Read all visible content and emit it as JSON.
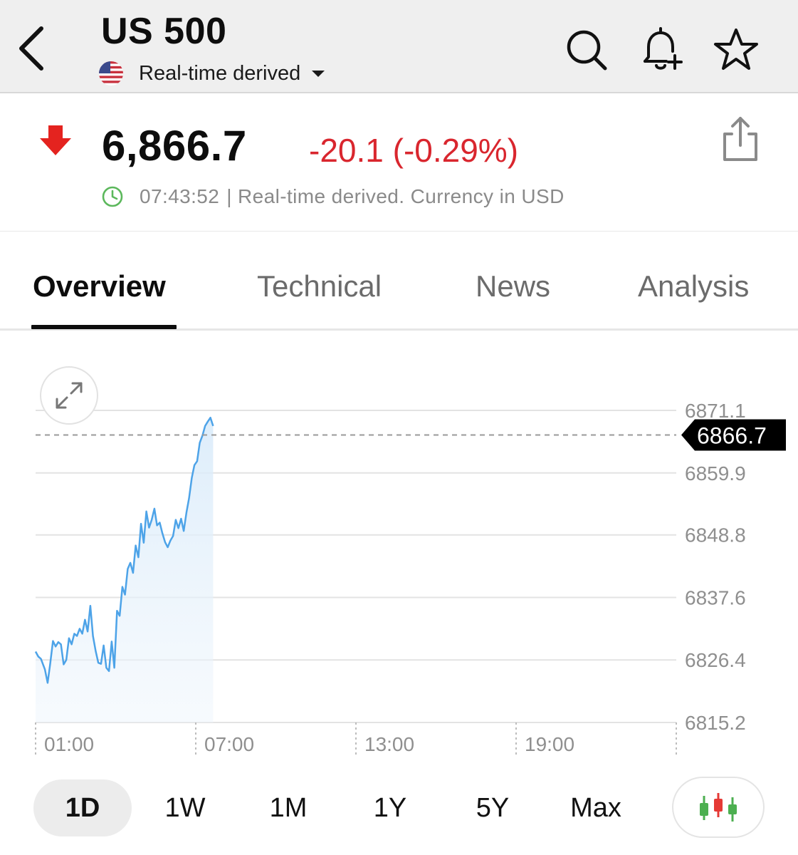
{
  "header": {
    "title": "US 500",
    "subtitle": "Real-time derived",
    "icons": {
      "back": "back-chevron-icon",
      "search": "search-icon",
      "alert": "bell-plus-icon",
      "watch": "star-icon",
      "flag": "us-flag-icon"
    }
  },
  "quote": {
    "price": "6,866.7",
    "change": "-20.1 (-0.29%)",
    "direction": "down",
    "time": "07:43:52",
    "note": "| Real-time derived. Currency in USD",
    "down_color": "#d9262e"
  },
  "tabs": [
    {
      "label": "Overview",
      "active": true
    },
    {
      "label": "Technical",
      "active": false
    },
    {
      "label": "News",
      "active": false
    },
    {
      "label": "Analysis",
      "active": false
    }
  ],
  "chart_data": {
    "type": "area",
    "y_ticks": [
      "6871.1",
      "6859.9",
      "6848.8",
      "6837.6",
      "6826.4",
      "6815.2"
    ],
    "ylim": [
      6815.2,
      6871.1
    ],
    "x_ticks": [
      "01:00",
      "07:00",
      "13:00",
      "19:00"
    ],
    "x_range_hours": [
      0,
      24
    ],
    "current_price_label": "6866.7",
    "current_price": 6866.7,
    "line_color": "#4da3e8",
    "grid": true,
    "series": [
      {
        "x": [
          0.0,
          0.1,
          0.2,
          0.35,
          0.45,
          0.55,
          0.65,
          0.75,
          0.85,
          0.95,
          1.05,
          1.15,
          1.25,
          1.35,
          1.45,
          1.55,
          1.65,
          1.75,
          1.85,
          1.95,
          2.05,
          2.15,
          2.25,
          2.35,
          2.45,
          2.55,
          2.65,
          2.75,
          2.85,
          2.95,
          3.05,
          3.15,
          3.25,
          3.35,
          3.45,
          3.55,
          3.65,
          3.75,
          3.85,
          3.95,
          4.05,
          4.15,
          4.25,
          4.35,
          4.45,
          4.55,
          4.65,
          4.75,
          4.85,
          4.95,
          5.05,
          5.15,
          5.25,
          5.35,
          5.45,
          5.55,
          5.65,
          5.75,
          5.85,
          5.95,
          6.05,
          6.15,
          6.25,
          6.35,
          6.45,
          6.55,
          6.65
        ],
        "y": [
          6827.9,
          6827.0,
          6826.6,
          6824.7,
          6822.3,
          6825.8,
          6829.8,
          6828.8,
          6829.6,
          6829.2,
          6825.6,
          6826.4,
          6830.3,
          6829.2,
          6831.1,
          6830.7,
          6832.0,
          6831.1,
          6833.6,
          6831.5,
          6836.1,
          6830.7,
          6828.0,
          6825.9,
          6825.7,
          6829.0,
          6825.0,
          6824.4,
          6829.7,
          6825.0,
          6835.2,
          6834.3,
          6839.5,
          6838.1,
          6842.7,
          6843.8,
          6842.0,
          6846.9,
          6844.8,
          6850.8,
          6847.4,
          6853.0,
          6850.1,
          6851.5,
          6853.5,
          6850.5,
          6851.0,
          6849.1,
          6847.5,
          6846.6,
          6847.8,
          6848.6,
          6851.5,
          6850.0,
          6851.7,
          6849.5,
          6852.8,
          6855.4,
          6859.0,
          6861.3,
          6862.0,
          6865.3,
          6866.6,
          6868.3,
          6869.1,
          6869.8,
          6868.3
        ]
      }
    ]
  },
  "ranges": [
    {
      "label": "1D",
      "active": true
    },
    {
      "label": "1W",
      "active": false
    },
    {
      "label": "1M",
      "active": false
    },
    {
      "label": "1Y",
      "active": false
    },
    {
      "label": "5Y",
      "active": false
    },
    {
      "label": "Max",
      "active": false
    }
  ],
  "chart_tools": {
    "expand": "expand-arrows-icon",
    "candlestick": "candlestick-icon"
  }
}
